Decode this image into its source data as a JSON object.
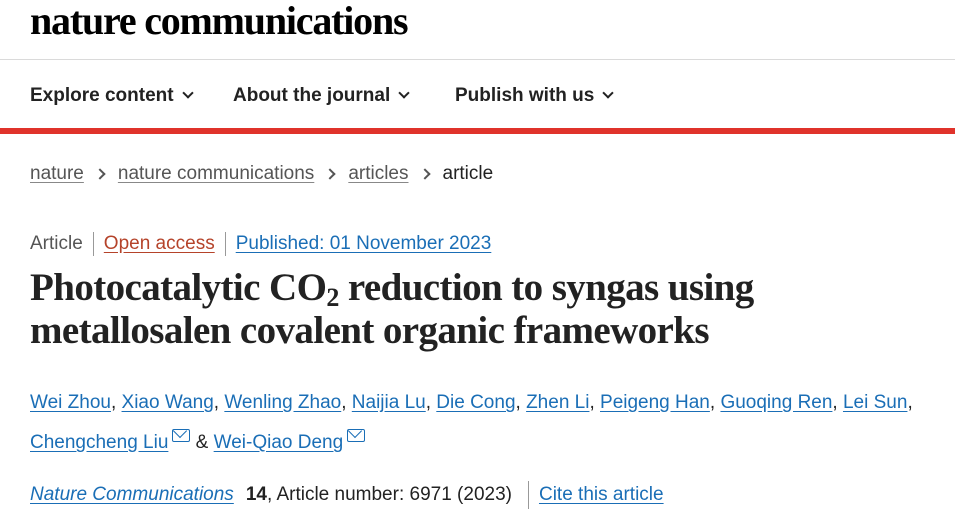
{
  "site": {
    "logo": "nature communications"
  },
  "nav": {
    "items": [
      {
        "label": "Explore content"
      },
      {
        "label": "About the journal"
      },
      {
        "label": "Publish with us"
      }
    ]
  },
  "breadcrumb": {
    "items": [
      "nature",
      "nature communications",
      "articles"
    ],
    "current": "article"
  },
  "meta": {
    "type": "Article",
    "access": "Open access",
    "published": "Published: 01 November 2023"
  },
  "article": {
    "title_part1": "Photocatalytic CO",
    "title_sub": "2",
    "title_part2": " reduction to syngas using metallosalen covalent organic frameworks"
  },
  "authors": [
    "Wei Zhou",
    "Xiao Wang",
    "Wenling Zhao",
    "Naijia Lu",
    "Die Cong",
    "Zhen Li",
    "Peigeng Han",
    "Guoqing Ren",
    "Lei Sun",
    "Chengcheng Liu",
    "Wei-Qiao Deng"
  ],
  "author_separators": {
    "comma": ",",
    "and": "&"
  },
  "citation": {
    "journal": "Nature Communications",
    "volume": "14",
    "rest": ", Article number: 6971 (2023)",
    "cite_label": "Cite this article"
  },
  "colors": {
    "accent_red": "#e0332b",
    "link_blue": "#1a6eb6",
    "open_access": "#b5432a"
  }
}
